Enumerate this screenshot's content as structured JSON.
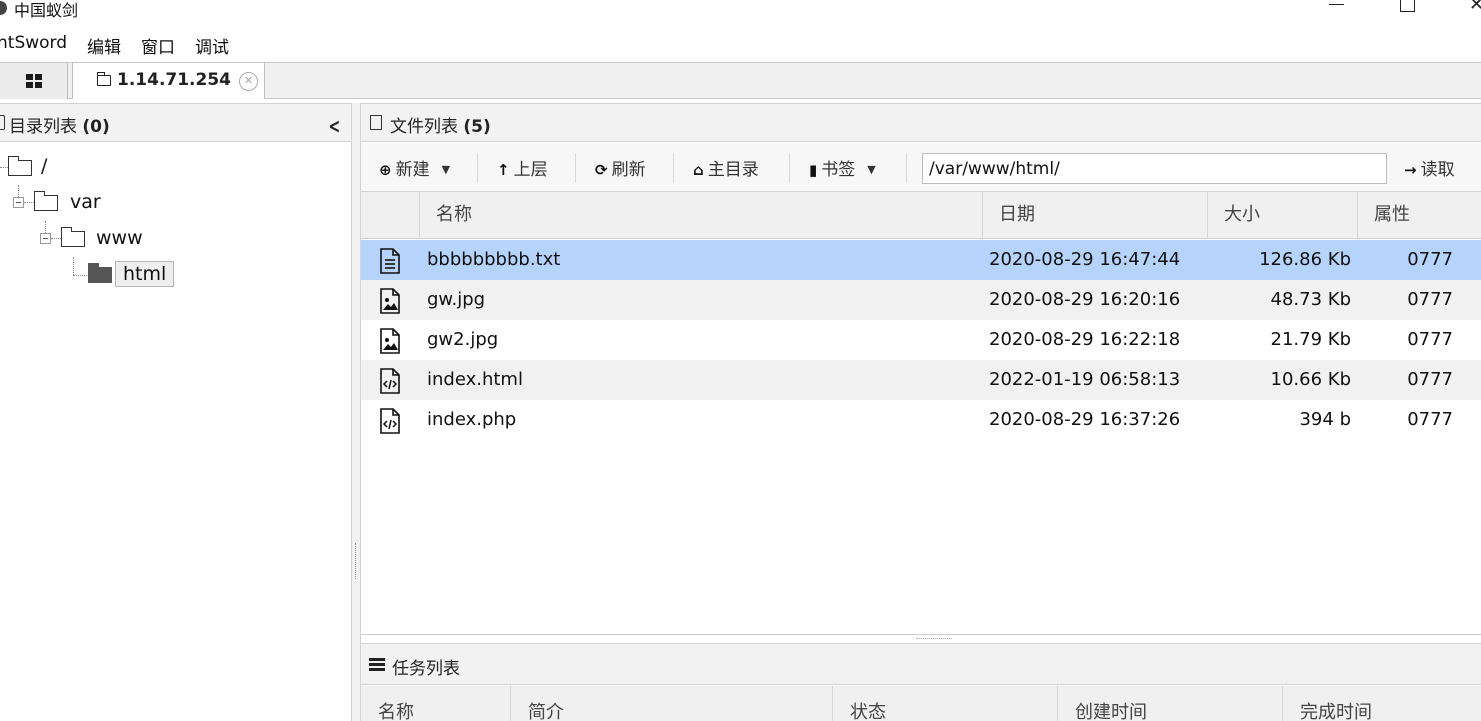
{
  "window": {
    "title": "中国蚁剑"
  },
  "menu": [
    "ntSword",
    "编辑",
    "窗口",
    "调试"
  ],
  "tabs": {
    "connection_label": "1.14.71.254"
  },
  "dir_panel": {
    "title": "目录列表",
    "count": "(0)",
    "tree": [
      {
        "label": "/",
        "expanded": true
      },
      {
        "label": "var",
        "expanded": true
      },
      {
        "label": "www",
        "expanded": true
      },
      {
        "label": "html",
        "selected": true
      }
    ]
  },
  "file_panel": {
    "title": "文件列表",
    "count": "(5)",
    "toolbar": {
      "new": "新建",
      "up": "上层",
      "refresh": "刷新",
      "home": "主目录",
      "bookmark": "书签",
      "path": "/var/www/html/",
      "read": "读取"
    },
    "columns": [
      "名称",
      "日期",
      "大小",
      "属性"
    ],
    "files": [
      {
        "icon": "text-file-icon",
        "name": "bbbbbbbbb.txt",
        "date": "2020-08-29 16:47:44",
        "size": "126.86 Kb",
        "perm": "0777",
        "selected": true
      },
      {
        "icon": "image-file-icon",
        "name": "gw.jpg",
        "date": "2020-08-29 16:20:16",
        "size": "48.73 Kb",
        "perm": "0777"
      },
      {
        "icon": "image-file-icon",
        "name": "gw2.jpg",
        "date": "2020-08-29 16:22:18",
        "size": "21.79 Kb",
        "perm": "0777"
      },
      {
        "icon": "code-file-icon",
        "name": "index.html",
        "date": "2022-01-19 06:58:13",
        "size": "10.66 Kb",
        "perm": "0777"
      },
      {
        "icon": "code-file-icon",
        "name": "index.php",
        "date": "2020-08-29 16:37:26",
        "size": "394 b",
        "perm": "0777"
      }
    ]
  },
  "task_panel": {
    "title": "任务列表",
    "columns": [
      "名称",
      "简介",
      "状态",
      "创建时间",
      "完成时间"
    ]
  },
  "colors": {
    "selected_row": "#b5d3fb",
    "panel_header": "#f2f2f2"
  }
}
